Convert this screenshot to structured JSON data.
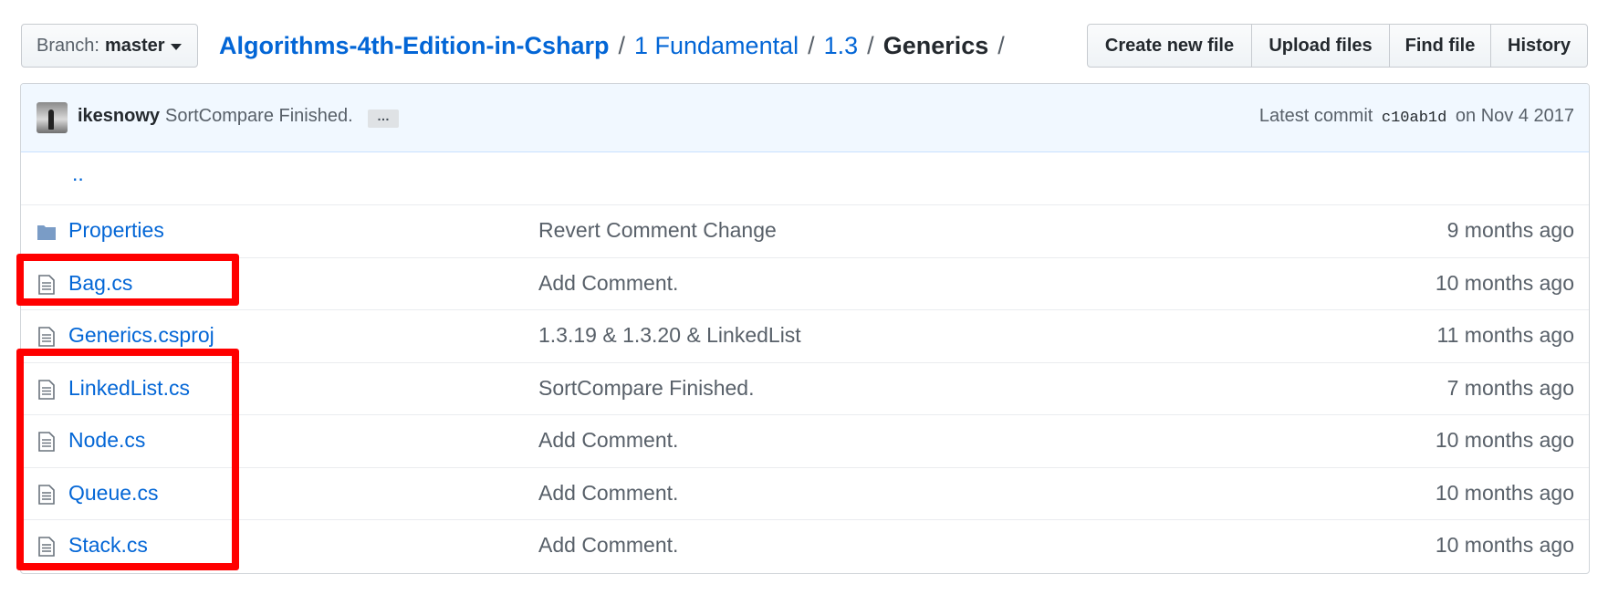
{
  "header": {
    "branch_label": "Branch:",
    "branch_value": "master",
    "breadcrumb": {
      "repo": "Algorithms-4th-Edition-in-Csharp",
      "sep": "/",
      "level1": "1 Fundamental",
      "level2": "1.3",
      "current": "Generics"
    },
    "buttons": {
      "create": "Create new file",
      "upload": "Upload files",
      "find": "Find file",
      "history": "History"
    }
  },
  "commit": {
    "author": "ikesnowy",
    "message": "SortCompare Finished.",
    "ellipsis": "…",
    "latest_label": "Latest commit",
    "sha": "c10ab1d",
    "date": "on Nov 4 2017"
  },
  "files": {
    "updir": "..",
    "rows": [
      {
        "name": "Properties",
        "type": "folder",
        "message": "Revert Comment Change",
        "age": "9 months ago"
      },
      {
        "name": "Bag.cs",
        "type": "file",
        "message": "Add Comment.",
        "age": "10 months ago"
      },
      {
        "name": "Generics.csproj",
        "type": "file",
        "message": "1.3.19 & 1.3.20 & LinkedList",
        "age": "11 months ago"
      },
      {
        "name": "LinkedList.cs",
        "type": "file",
        "message": "SortCompare Finished.",
        "age": "7 months ago"
      },
      {
        "name": "Node.cs",
        "type": "file",
        "message": "Add Comment.",
        "age": "10 months ago"
      },
      {
        "name": "Queue.cs",
        "type": "file",
        "message": "Add Comment.",
        "age": "10 months ago"
      },
      {
        "name": "Stack.cs",
        "type": "file",
        "message": "Add Comment.",
        "age": "10 months ago"
      }
    ]
  },
  "colors": {
    "link": "#0366d6",
    "muted": "#586069",
    "highlight": "#ff0000",
    "commit_bg": "#f1f8ff"
  }
}
